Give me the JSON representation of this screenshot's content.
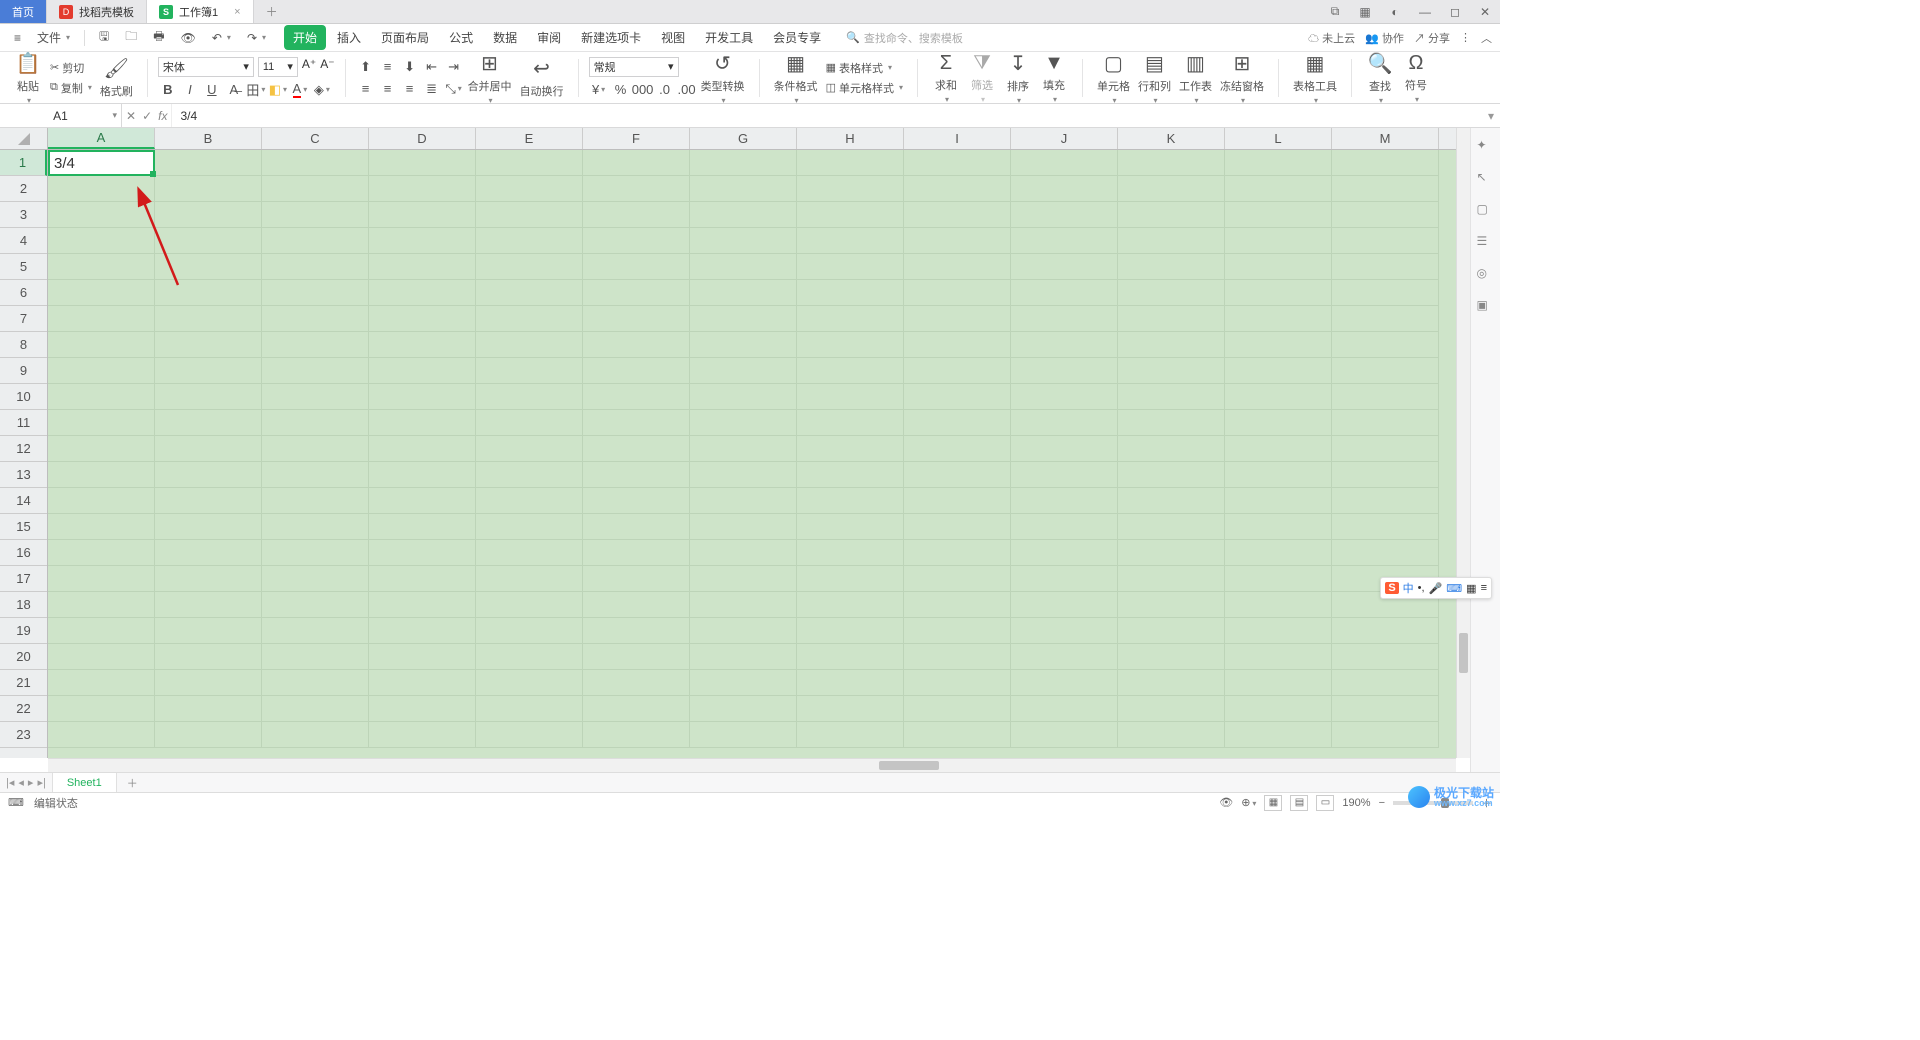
{
  "titlebar": {
    "home": "首页",
    "tab1": "找稻壳模板",
    "tab2": "工作簿1"
  },
  "menubar": {
    "file": "文件",
    "tabs": [
      "开始",
      "插入",
      "页面布局",
      "公式",
      "数据",
      "审阅",
      "新建选项卡",
      "视图",
      "开发工具",
      "会员专享"
    ],
    "search_hint": "查找命令、搜索模板",
    "cloud": "未上云",
    "coop": "协作",
    "share": "分享"
  },
  "ribbon": {
    "paste": "粘贴",
    "cut": "剪切",
    "copy": "复制",
    "format_painter": "格式刷",
    "font_name": "宋体",
    "font_size": "11",
    "merge": "合并居中",
    "wrap": "自动换行",
    "number_format": "常规",
    "type_convert": "类型转换",
    "cond_format": "条件格式",
    "table_style": "表格样式",
    "cell_style": "单元格样式",
    "sum": "求和",
    "filter": "筛选",
    "sort": "排序",
    "fill": "填充",
    "cell": "单元格",
    "rowcol": "行和列",
    "worksheet": "工作表",
    "freeze": "冻结窗格",
    "table_tools": "表格工具",
    "find": "查找",
    "symbol": "符号"
  },
  "formula_bar": {
    "namebox": "A1",
    "formula": "3/4"
  },
  "grid": {
    "columns": [
      "A",
      "B",
      "C",
      "D",
      "E",
      "F",
      "G",
      "H",
      "I",
      "J",
      "K",
      "L",
      "M"
    ],
    "rows": [
      "1",
      "2",
      "3",
      "4",
      "5",
      "6",
      "7",
      "8",
      "9",
      "10",
      "11",
      "12",
      "13",
      "14",
      "15",
      "16",
      "17",
      "18",
      "19",
      "20",
      "21",
      "22",
      "23"
    ],
    "active_cell_value": "3/4"
  },
  "sheettabs": {
    "sheet1": "Sheet1"
  },
  "statusbar": {
    "mode": "编辑状态",
    "zoom": "190%"
  },
  "ime": {
    "lang": "中"
  },
  "watermark": {
    "text1": "极光下载站",
    "text2": "www.xz7.com"
  }
}
